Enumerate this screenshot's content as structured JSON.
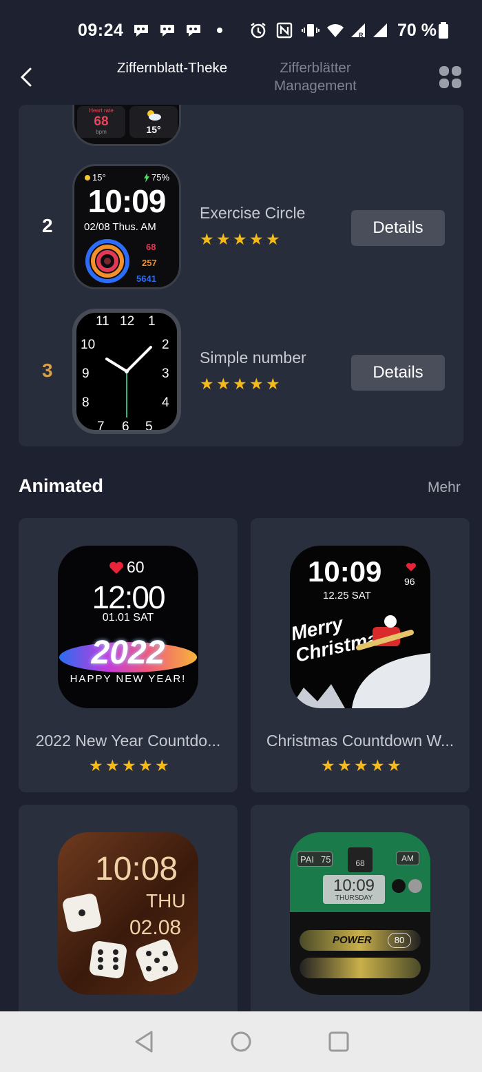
{
  "status_bar": {
    "time": "09:24",
    "battery": "70 %",
    "icons": [
      "chat-bubble-icon",
      "chat-bubble-icon",
      "chat-bubble-icon",
      "dot-icon",
      "alarm-icon",
      "nfc-icon",
      "vibrate-icon",
      "wifi-icon",
      "signal-r-icon",
      "signal-icon",
      "battery-icon"
    ]
  },
  "header": {
    "back_icon": "chevron-left-icon",
    "tab_active": "Ziffernblatt-Theke",
    "tab_inactive": "Zifferblätter Management",
    "grid_icon": "grid-icon"
  },
  "top_partial_face": {
    "heart_rate_label": "Heart rate",
    "heart_rate_value": "68",
    "heart_rate_unit": "bpm",
    "weather_temp": "15°"
  },
  "ranking": [
    {
      "rank": "2",
      "name": "Exercise Circle",
      "rating": 5,
      "details_label": "Details",
      "face": {
        "temp": "15°",
        "battery": "75%",
        "time": "10:09",
        "date": "02/08 Thus. AM",
        "stat1": "68",
        "stat2": "257",
        "stat3": "5641"
      }
    },
    {
      "rank": "3",
      "name": "Simple number",
      "rating": 5,
      "details_label": "Details",
      "face": {
        "numbers": [
          "11",
          "12",
          "1",
          "2",
          "3",
          "4",
          "5",
          "6",
          "7",
          "8",
          "9",
          "10"
        ]
      }
    }
  ],
  "animated": {
    "title": "Animated",
    "more_label": "Mehr",
    "items": [
      {
        "name": "2022 New Year Countdo...",
        "rating": 5,
        "face": {
          "heart": "60",
          "time": "12:00",
          "date": "01.01 SAT",
          "year": "2022",
          "caption": "HAPPY NEW YEAR!"
        }
      },
      {
        "name": "Christmas Countdown W...",
        "rating": 5,
        "face": {
          "time": "10:09",
          "date": "12.25 SAT",
          "heart": "96",
          "greeting": "Merry Christmas"
        }
      },
      {
        "name": "",
        "rating": 0,
        "face": {
          "time": "10:08",
          "day": "THU",
          "date": "02.08"
        }
      },
      {
        "name": "",
        "rating": 0,
        "face": {
          "pai": "PAI",
          "pai_value": "75",
          "heart": "68",
          "ampm": "AM",
          "time": "10:09",
          "day": "THURSDAY",
          "power": "POWER",
          "power_value": "80"
        }
      }
    ]
  },
  "colors": {
    "background": "#1e2230",
    "card": "#282d3b",
    "star": "#f7b916",
    "rank3": "#d6a04a",
    "button": "#4a4e5a"
  },
  "nav_bar": {
    "icons": [
      "back-triangle-icon",
      "home-circle-icon",
      "recents-square-icon"
    ]
  }
}
